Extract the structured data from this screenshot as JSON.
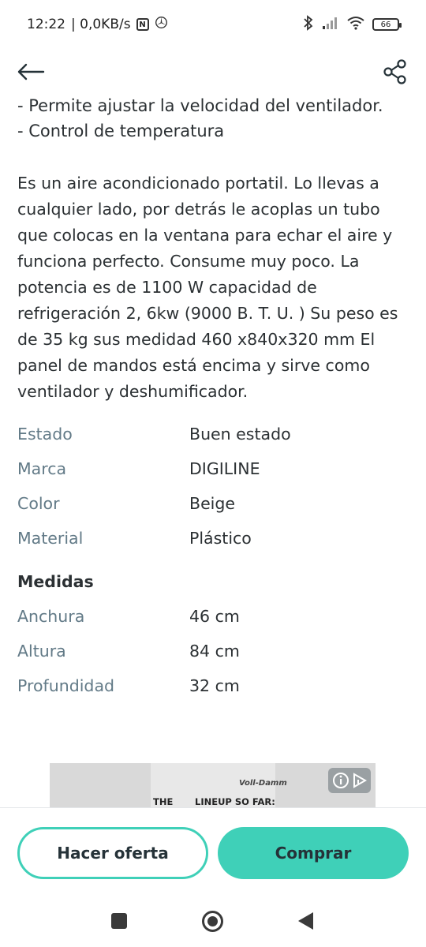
{
  "status_bar": {
    "time": "12:22",
    "speed": "| 0,0KB/s",
    "nfc": "N",
    "battery": "66"
  },
  "content": {
    "clipped_line": "- Permite ajustar la velocidad del ventilador.",
    "bullet": "- Control de temperatura",
    "description_lines": [
      "Es un aire acondicionado portatil. Lo llevas a",
      "cualquier lado, por detrás le acoplas un tubo",
      "que colocas en la ventana para echar el aire y",
      "funciona perfecto. Consume muy poco. La",
      "potencia es de 1100 W capacidad de",
      "refrigeración 2, 6kw (9000 B. T. U. ) Su peso es",
      "de 35 kg sus medidad 460 x840x320 mm El",
      "panel de mandos está encima y sirve como",
      "ventilador y deshumificador."
    ],
    "specs": [
      {
        "label": "Estado",
        "value": "Buen estado"
      },
      {
        "label": "Marca",
        "value": "DIGILINE"
      },
      {
        "label": "Color",
        "value": "Beige"
      },
      {
        "label": "Material",
        "value": "Plástico"
      }
    ],
    "measures_title": "Medidas",
    "measures": [
      {
        "label": "Anchura",
        "value": "46 cm"
      },
      {
        "label": "Altura",
        "value": "84 cm"
      },
      {
        "label": "Profundidad",
        "value": "32 cm"
      }
    ]
  },
  "ad": {
    "brand": "Voll-Damm",
    "text_left": "THE",
    "text_right": "LINEUP SO FAR:"
  },
  "actions": {
    "offer_label": "Hacer oferta",
    "buy_label": "Comprar"
  },
  "colors": {
    "accent": "#3fd0b8",
    "label": "#627a87",
    "text": "#2b3033"
  }
}
